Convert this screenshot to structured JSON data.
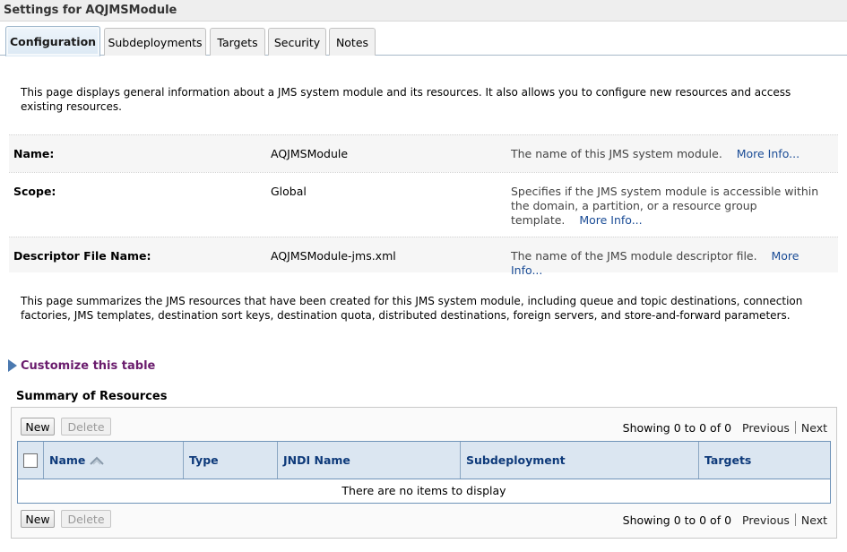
{
  "page": {
    "title": "Settings for AQJMSModule"
  },
  "tabs": [
    {
      "label": "Configuration",
      "active": true
    },
    {
      "label": "Subdeployments"
    },
    {
      "label": "Targets"
    },
    {
      "label": "Security"
    },
    {
      "label": "Notes"
    }
  ],
  "intro": "This page displays general information about a JMS system module and its resources. It also allows you to configure new resources and access existing resources.",
  "fields": [
    {
      "label": "Name:",
      "value": "AQJMSModule",
      "desc": "The name of this JMS system module.",
      "more": "More Info..."
    },
    {
      "label": "Scope:",
      "value": "Global",
      "desc": "Specifies if the JMS system module is accessible within the domain, a partition, or a resource group template.",
      "more": "More Info..."
    },
    {
      "label": "Descriptor File Name:",
      "value": "AQJMSModule-jms.xml",
      "desc": "The name of the JMS module descriptor file.",
      "more": "More Info..."
    }
  ],
  "summary_text": "This page summarizes the JMS resources that have been created for this JMS system module, including queue and topic destinations, connection factories, JMS templates, destination sort keys, destination quota, distributed destinations, foreign servers, and store-and-forward parameters.",
  "customize_label": "Customize this table",
  "table": {
    "title": "Summary of Resources",
    "buttons": {
      "new": "New",
      "delete": "Delete"
    },
    "pager": {
      "count": "Showing 0 to 0 of 0",
      "previous": "Previous",
      "next": "Next"
    },
    "columns": [
      "Name",
      "Type",
      "JNDI Name",
      "Subdeployment",
      "Targets"
    ],
    "empty_message": "There are no items to display"
  },
  "colors": {
    "link": "#1a4c96",
    "customize": "#6a1c6d",
    "header_bg": "#dbe6f1",
    "header_text": "#0e3a7a"
  }
}
